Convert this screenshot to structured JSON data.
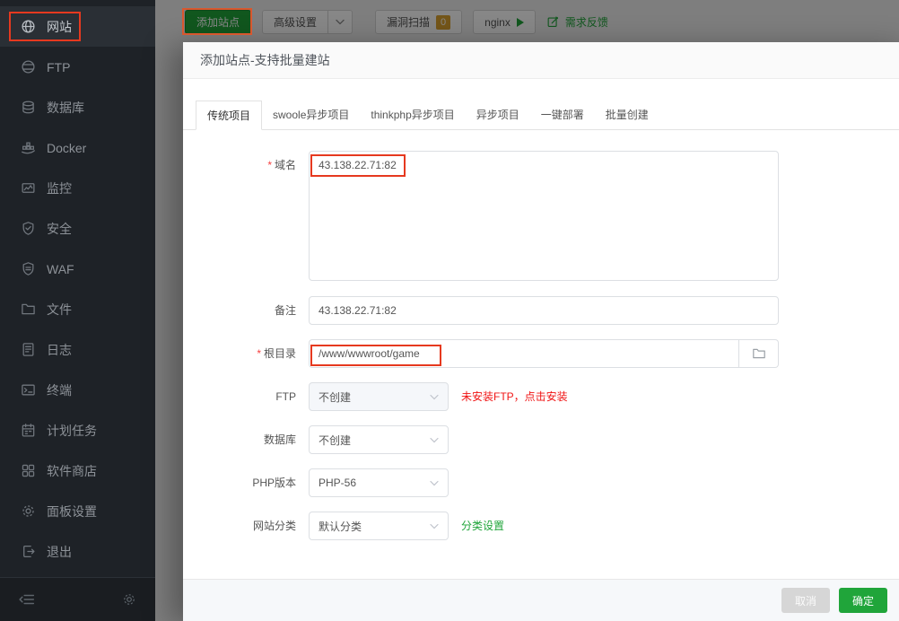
{
  "sidebar": {
    "items": [
      {
        "label": "网站"
      },
      {
        "label": "FTP"
      },
      {
        "label": "数据库"
      },
      {
        "label": "Docker"
      },
      {
        "label": "监控"
      },
      {
        "label": "安全"
      },
      {
        "label": "WAF"
      },
      {
        "label": "文件"
      },
      {
        "label": "日志"
      },
      {
        "label": "终端"
      },
      {
        "label": "计划任务"
      },
      {
        "label": "软件商店"
      },
      {
        "label": "面板设置"
      },
      {
        "label": "退出"
      }
    ]
  },
  "toolbar": {
    "add_site": "添加站点",
    "advanced": "高级设置",
    "scan": "漏洞扫描",
    "scan_badge": "0",
    "webserver": "nginx",
    "feedback": "需求反馈"
  },
  "modal": {
    "title": "添加站点-支持批量建站",
    "tabs": [
      "传统项目",
      "swoole异步项目",
      "thinkphp异步项目",
      "异步项目",
      "一键部署",
      "批量创建"
    ],
    "form": {
      "domain_label": "域名",
      "domain_value": "43.138.22.71:82",
      "note_label": "备注",
      "note_value": "43.138.22.71:82",
      "root_label": "根目录",
      "root_value": "/www/wwwroot/game",
      "ftp_label": "FTP",
      "ftp_value": "不创建",
      "ftp_warning": "未安装FTP，点击安装",
      "db_label": "数据库",
      "db_value": "不创建",
      "php_label": "PHP版本",
      "php_value": "PHP-56",
      "category_label": "网站分类",
      "category_value": "默认分类",
      "category_link": "分类设置"
    },
    "footer": {
      "cancel": "取消",
      "confirm": "确定"
    }
  },
  "colors": {
    "accent_green": "#20a53a",
    "warning_red": "#f01414",
    "annotation_red": "#e6391f",
    "badge_gold": "#dca230",
    "sidebar_bg": "#1e2227"
  }
}
